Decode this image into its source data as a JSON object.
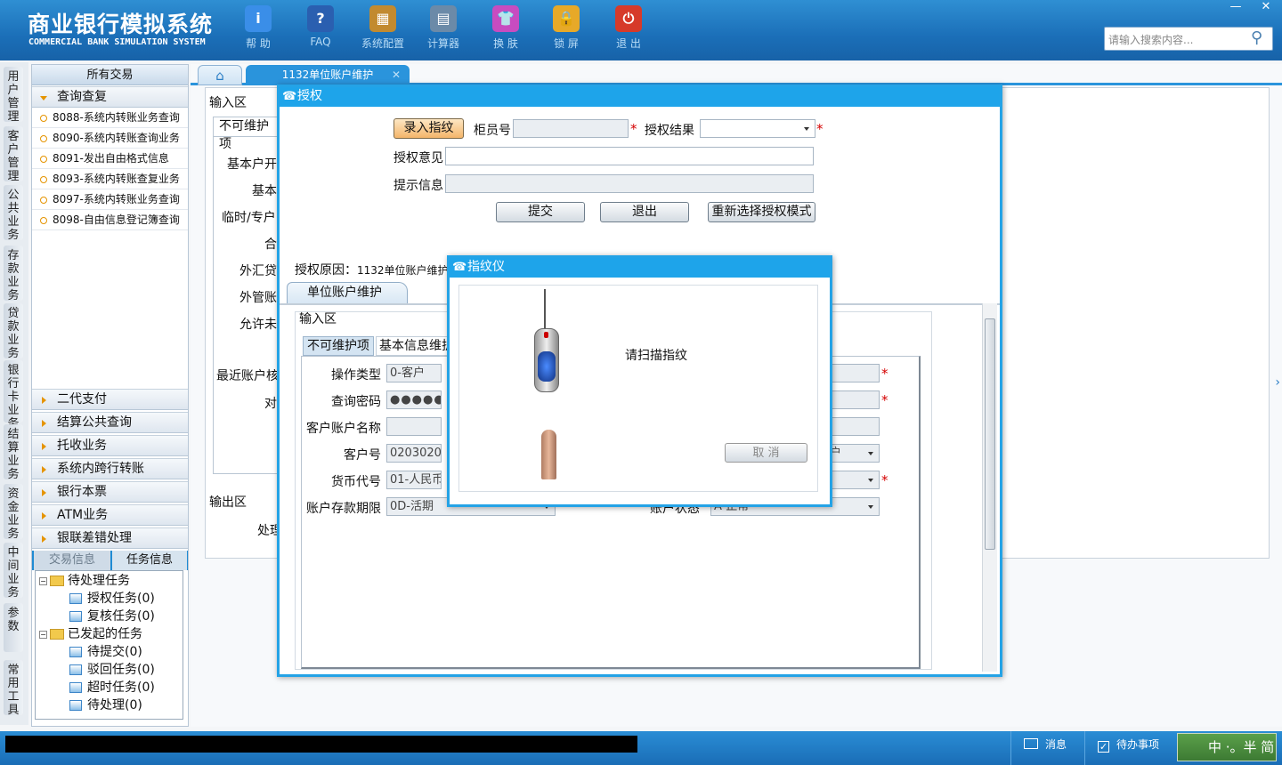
{
  "header": {
    "title_cn": "商业银行模拟系统",
    "title_en": "COMMERCIAL BANK SIMULATION SYSTEM",
    "toolbar": [
      {
        "label": "帮 助",
        "icon": "info-icon"
      },
      {
        "label": "FAQ",
        "icon": "help-icon"
      },
      {
        "label": "系统配置",
        "icon": "toolbox-icon"
      },
      {
        "label": "计算器",
        "icon": "calculator-icon"
      },
      {
        "label": "换 肤",
        "icon": "shirt-icon"
      },
      {
        "label": "锁 屏",
        "icon": "lock-icon"
      },
      {
        "label": "退 出",
        "icon": "power-icon"
      }
    ],
    "search_placeholder": "请输入搜索内容...",
    "minimize": "—",
    "close": "✕"
  },
  "vtabs": [
    "用户管理",
    "客户管理",
    "公共业务",
    "存款业务",
    "贷款业务",
    "银行卡业务",
    "结算业务",
    "资金业务",
    "中间业务",
    "参数",
    "常用工具"
  ],
  "sidebar": {
    "header": "所有交易",
    "open_category": "查询查复",
    "items": [
      "8088-系统内转账业务查询",
      "8090-系统内转账查询业务",
      "8091-发出自由格式信息",
      "8093-系统内转账查复业务",
      "8097-系统内转账业务查询",
      "8098-自由信息登记簿查询"
    ],
    "categories": [
      "二代支付",
      "结算公共查询",
      "托收业务",
      "系统内跨行转账",
      "银行本票",
      "ATM业务",
      "银联差错处理"
    ],
    "bottom_tabs": [
      "交易信息",
      "任务信息"
    ],
    "tree": [
      {
        "label": "待处理任务",
        "level": 0,
        "type": "folder"
      },
      {
        "label": "授权任务(0)",
        "level": 1,
        "type": "doc"
      },
      {
        "label": "复核任务(0)",
        "level": 1,
        "type": "doc"
      },
      {
        "label": "已发起的任务",
        "level": 0,
        "type": "folder"
      },
      {
        "label": "待提交(0)",
        "level": 1,
        "type": "doc"
      },
      {
        "label": "驳回任务(0)",
        "level": 1,
        "type": "doc"
      },
      {
        "label": "超时任务(0)",
        "level": 1,
        "type": "doc"
      },
      {
        "label": "待处理(0)",
        "level": 1,
        "type": "doc"
      }
    ]
  },
  "main": {
    "tabs": [
      "1132单位账户维护"
    ],
    "bg": {
      "input_area": "输入区",
      "tab": "不可维护项",
      "labels": [
        "基本户开",
        "基本",
        "临时/专户",
        "合",
        "外汇贷",
        "外管账",
        "允许未"
      ],
      "last_check": "最近账户核",
      "dui": "对",
      "output_area": "输出区",
      "handle": "处理"
    }
  },
  "auth": {
    "title": "授权",
    "fingerprint_btn": "录入指纹",
    "teller_label": "柜员号",
    "result_label": "授权结果",
    "opinion_label": "授权意见",
    "hint_label": "提示信息",
    "submit": "提交",
    "exit": "退出",
    "reselect": "重新选择授权模式",
    "reason_label": "授权原因：",
    "reason_value": "1132单位账户维护",
    "inner_tab": "单位账户维护",
    "input_area": "输入区",
    "tabs": [
      "不可维护项",
      "基本信息维护"
    ],
    "fields": [
      {
        "label": "操作类型",
        "value": "0-客户"
      },
      {
        "label": "查询密码",
        "value": "●●●●●"
      },
      {
        "label": "客户账户名称",
        "value": ""
      },
      {
        "label": "客户号",
        "value": "02030208"
      },
      {
        "label": "货币代号",
        "value": "01-人民币"
      },
      {
        "label": "账户存款期限",
        "value": "0D-活期"
      }
    ],
    "right_fields": [
      {
        "label": "",
        "value": ""
      },
      {
        "label": "",
        "value": ""
      },
      {
        "label": "",
        "value": ""
      },
      {
        "label": "",
        "value": "户"
      },
      {
        "label": "",
        "value": ""
      },
      {
        "label": "账户状态",
        "value": "A-正常"
      }
    ]
  },
  "fp": {
    "title": "指纹仪",
    "prompt": "请扫描指纹",
    "cancel": "取 消"
  },
  "status": {
    "message": "消息",
    "todo": "待办事项",
    "ime": "中 ·。半 简"
  }
}
